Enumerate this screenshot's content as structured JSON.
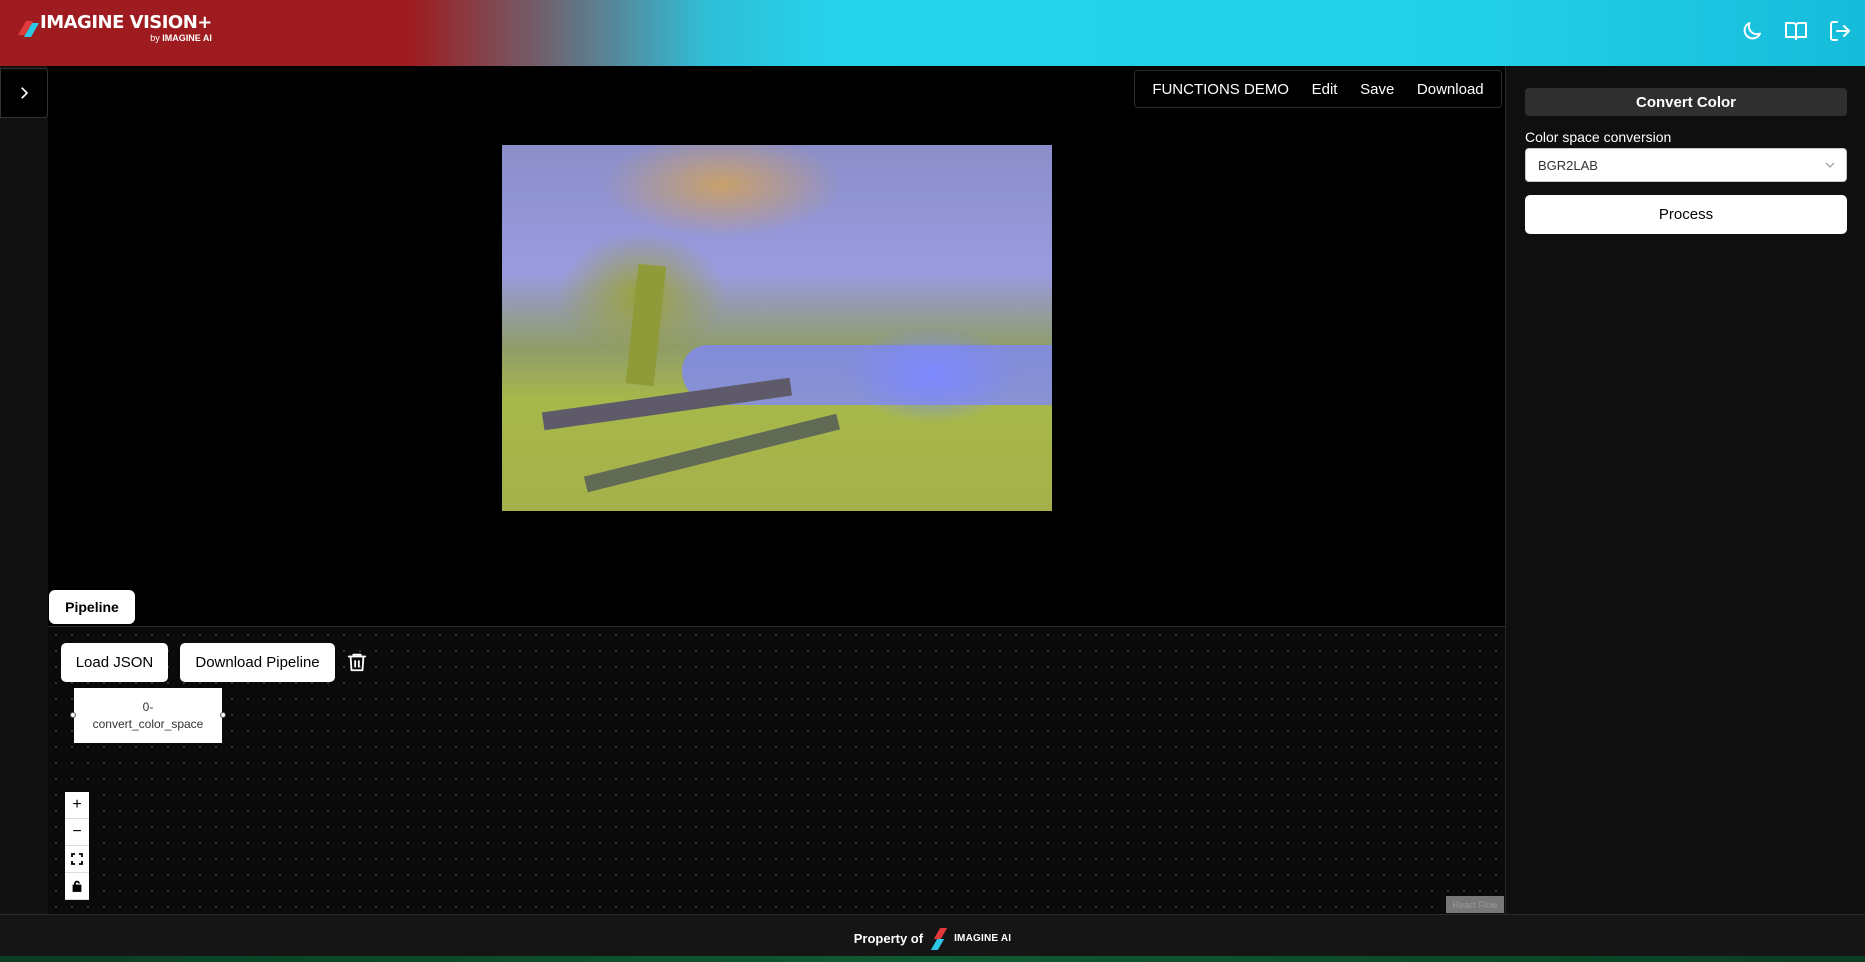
{
  "header": {
    "brand_title": "IMAGINE VISION+",
    "brand_sub_by": "by",
    "brand_sub_name": "IMAGINE AI",
    "icons": [
      "moon-icon",
      "book-icon",
      "logout-icon"
    ]
  },
  "toolbar": {
    "functions_demo": "FUNCTIONS DEMO",
    "edit": "Edit",
    "save": "Save",
    "download": "Download"
  },
  "pipeline": {
    "tab_label": "Pipeline",
    "load_json": "Load JSON",
    "download_pipeline": "Download Pipeline",
    "node_index": "0-",
    "node_name": "convert_color_space",
    "attribution": "React Flow"
  },
  "zoom": {
    "zoom_in": "+",
    "zoom_out": "−"
  },
  "panel": {
    "title": "Convert Color",
    "field_label": "Color space conversion",
    "selected_value": "BGR2LAB",
    "process_label": "Process"
  },
  "footer": {
    "property_of": "Property of",
    "logo_text": "IMAGINE AI"
  },
  "colors": {
    "brand_red": "#9e1c1f",
    "brand_cyan": "#22cfe8"
  }
}
